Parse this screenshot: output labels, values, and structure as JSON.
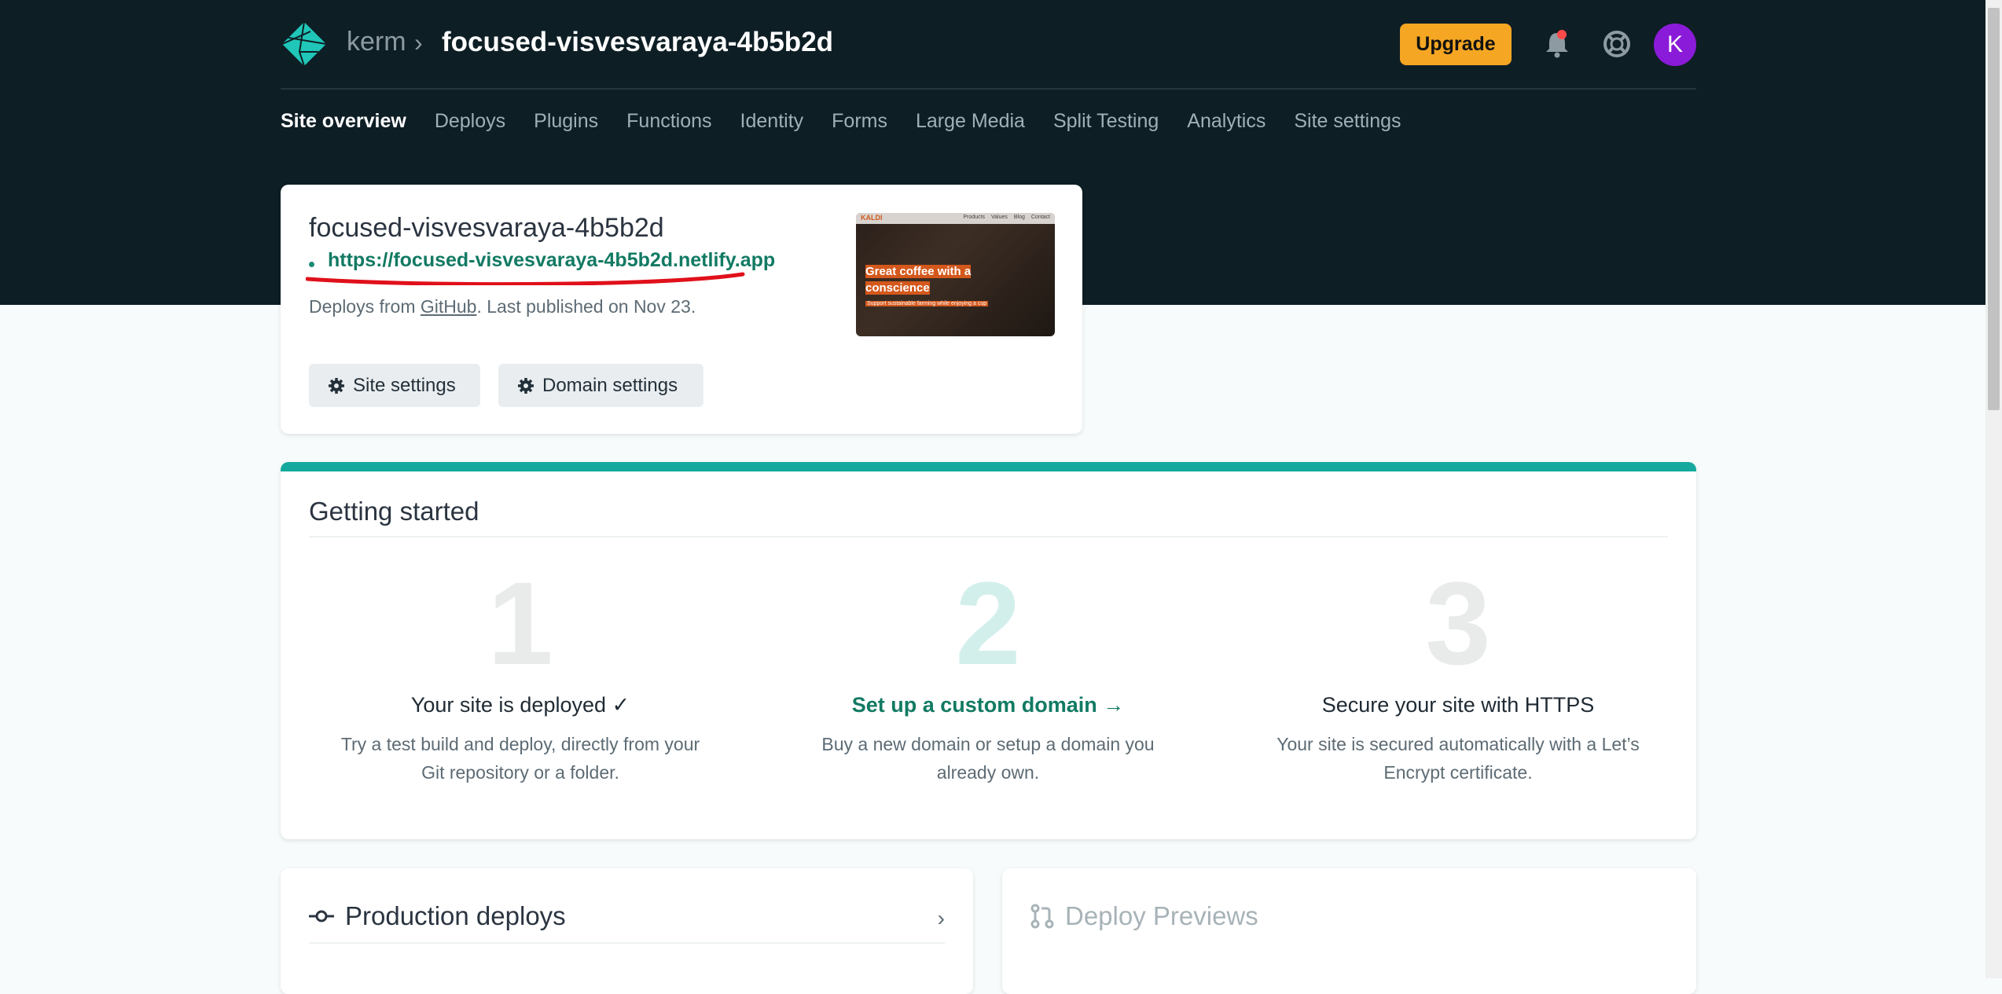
{
  "header": {
    "team": "kerm",
    "separator": "›",
    "site_name": "focused-visvesvaraya-4b5b2d",
    "upgrade_label": "Upgrade",
    "avatar_initial": "K"
  },
  "nav": {
    "items": [
      "Site overview",
      "Deploys",
      "Plugins",
      "Functions",
      "Identity",
      "Forms",
      "Large Media",
      "Split Testing",
      "Analytics",
      "Site settings"
    ],
    "active": "Site overview"
  },
  "site_card": {
    "title": "focused-visvesvaraya-4b5b2d",
    "url": "https://focused-visvesvaraya-4b5b2d.netlify.app",
    "deploys_from_prefix": "Deploys from ",
    "deploys_from_link": "GitHub",
    "deploys_from_suffix": ". Last published on Nov 23.",
    "site_settings_button": "Site settings",
    "domain_settings_button": "Domain settings",
    "thumbnail": {
      "brand": "KALDI",
      "links": [
        "Products",
        "Values",
        "Blog",
        "Contact"
      ],
      "headline": "Great coffee with a conscience",
      "subline": "Support sustainable farming while enjoying a cup"
    }
  },
  "getting_started": {
    "title": "Getting started",
    "steps": [
      {
        "number": "1",
        "heading": "Your site is deployed ✓",
        "description": "Try a test build and deploy, directly from your Git repository or a folder."
      },
      {
        "number": "2",
        "heading": "Set up a custom domain →",
        "description": "Buy a new domain or setup a domain you already own."
      },
      {
        "number": "3",
        "heading": "Secure your site with HTTPS",
        "description": "Your site is secured automatically with a Let’s Encrypt certificate."
      }
    ]
  },
  "production_deploys": {
    "title": "Production deploys",
    "chevron": "›"
  },
  "deploy_previews": {
    "title": "Deploy Previews"
  },
  "colors": {
    "header_bg": "#0e1e25",
    "accent_teal": "#14a99c",
    "link_green": "#127a63",
    "upgrade_orange": "#f5a623",
    "avatar_purple": "#8a1bd8",
    "annotation_red": "#e0101a"
  },
  "icons": [
    "netlify-logo-icon",
    "bell-icon",
    "help-lifebuoy-icon",
    "gear-icon",
    "commit-icon",
    "pull-request-icon"
  ]
}
